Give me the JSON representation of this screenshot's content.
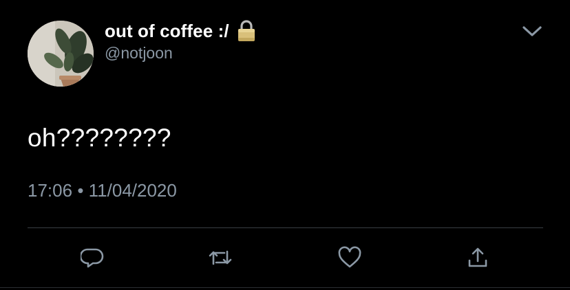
{
  "tweet": {
    "author": {
      "display_name": "out of coffee :/",
      "handle": "@notjoon",
      "protected_icon": "lock-icon",
      "avatar_icon": "plant-photo-avatar"
    },
    "menu_icon": "chevron-down-icon",
    "text": "oh????????",
    "meta": {
      "time": "17:06",
      "separator": "•",
      "date": "11/04/2020"
    },
    "actions": [
      {
        "name": "reply",
        "icon": "reply-icon"
      },
      {
        "name": "retweet",
        "icon": "retweet-icon"
      },
      {
        "name": "like",
        "icon": "heart-icon"
      },
      {
        "name": "share",
        "icon": "share-icon"
      }
    ]
  },
  "colors": {
    "background": "#000000",
    "primary_text": "#ffffff",
    "secondary_text": "#8b98a5",
    "divider": "#3a3f44"
  }
}
